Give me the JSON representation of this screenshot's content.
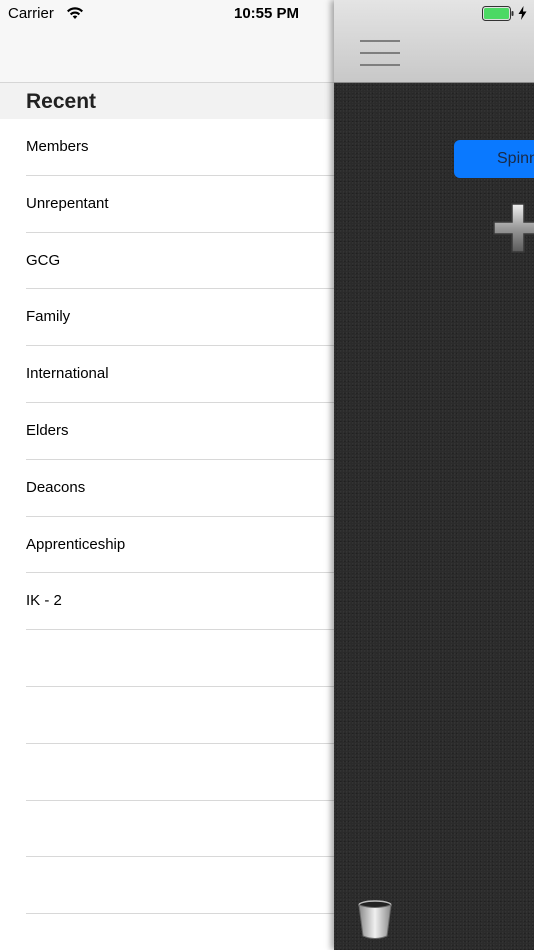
{
  "status_bar": {
    "carrier": "Carrier",
    "time": "10:55 PM",
    "icons": [
      "wifi-icon",
      "battery-icon",
      "charging-bolt-icon"
    ],
    "battery_color": "#4cd964"
  },
  "menu": {
    "section_title": "Recent",
    "items": [
      {
        "label": "Members"
      },
      {
        "label": "Unrepentant"
      },
      {
        "label": "GCG"
      },
      {
        "label": "Family"
      },
      {
        "label": "International"
      },
      {
        "label": "Elders"
      },
      {
        "label": "Deacons"
      },
      {
        "label": "Apprenticeship"
      },
      {
        "label": "IK - 2"
      },
      {
        "label": ""
      },
      {
        "label": ""
      },
      {
        "label": ""
      },
      {
        "label": ""
      },
      {
        "label": ""
      }
    ]
  },
  "main": {
    "spin_button_label": "Spinn",
    "icons": [
      "hamburger-menu-icon",
      "plus-icon",
      "trash-bin-icon"
    ],
    "accent_color": "#0a79ff"
  }
}
